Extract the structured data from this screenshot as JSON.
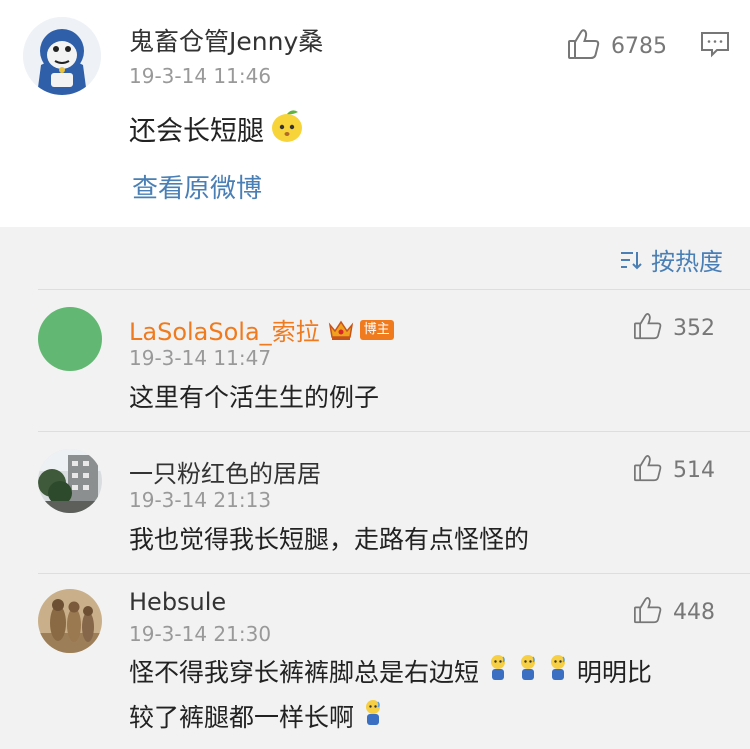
{
  "post": {
    "author": "鬼畜仓管Jenny桑",
    "time": "19-3-14 11:46",
    "content": "还会长短腿",
    "content_emoji": "lemon-face-emoji",
    "view_original": "查看原微博",
    "likes": "6785",
    "icons": {
      "like": "thumbs-up-icon",
      "comment": "comment-icon"
    }
  },
  "sort": {
    "label": "按热度",
    "icon": "sort-icon"
  },
  "comments": [
    {
      "author": "LaSolaSola_索拉",
      "badge": "博主",
      "vip": true,
      "time": "19-3-14 11:47",
      "likes": "352",
      "text": "这里有个活生生的例子",
      "avatar": "green-circle"
    },
    {
      "author": "一只粉红色的居居",
      "time": "19-3-14 21:13",
      "likes": "514",
      "text": "我也觉得我长短腿，走路有点怪怪的",
      "avatar": "building-photo"
    },
    {
      "author": "Hebsule",
      "time": "19-3-14 21:30",
      "likes": "448",
      "text_part1": "怪不得我穿长裤裤脚总是右边短",
      "text_part2": "明明比",
      "text_part3": "较了裤腿都一样长啊",
      "avatar": "meerkat-photo"
    }
  ],
  "colors": {
    "accent": "#4a7fb5",
    "vip": "#f07a1e",
    "muted": "#999999"
  }
}
